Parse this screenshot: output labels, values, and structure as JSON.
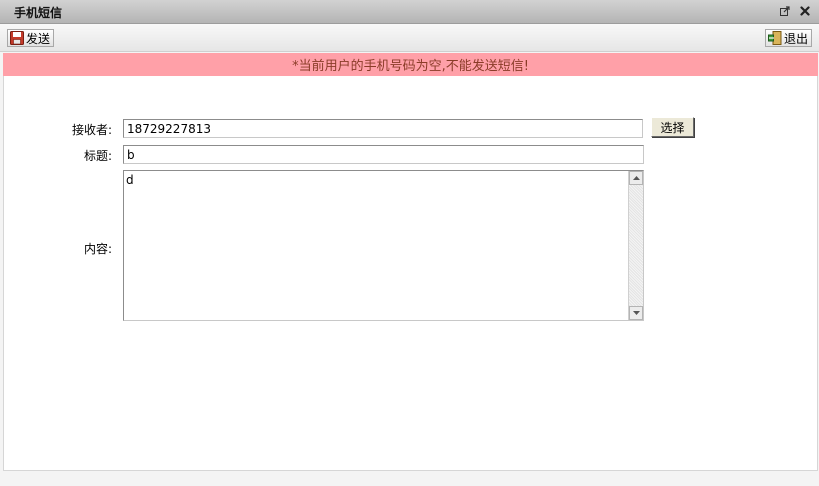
{
  "window": {
    "title": "手机短信",
    "icons": [
      "popout-icon",
      "close-icon"
    ]
  },
  "toolbar": {
    "send_label": "发送",
    "exit_label": "退出"
  },
  "alert": {
    "message": "*当前用户的手机号码为空,不能发送短信!",
    "bg_color": "#ffa0a8",
    "text_color": "#8a3c28"
  },
  "form": {
    "receiver_label": "接收者:",
    "receiver_value": "18729227813",
    "select_label": "选择",
    "subject_label": "标题:",
    "subject_value": "b",
    "content_label": "内容:",
    "content_value": "d"
  }
}
